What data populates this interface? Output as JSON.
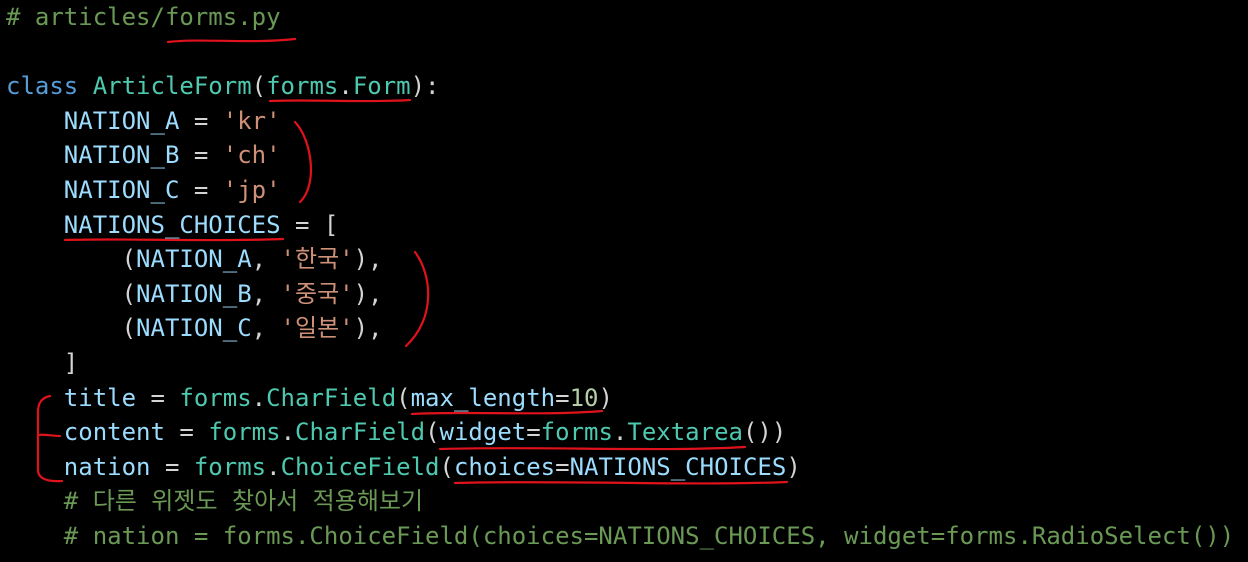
{
  "editor": {
    "language": "python",
    "lines": [
      [
        {
          "t": "# articles/forms.py",
          "c": "cm"
        }
      ],
      [],
      [
        {
          "t": "class",
          "c": "kw"
        },
        {
          "t": " ",
          "c": "pun"
        },
        {
          "t": "ArticleForm",
          "c": "cls"
        },
        {
          "t": "(",
          "c": "pun"
        },
        {
          "t": "forms",
          "c": "cls"
        },
        {
          "t": ".",
          "c": "pun"
        },
        {
          "t": "Form",
          "c": "cls"
        },
        {
          "t": "):",
          "c": "pun"
        }
      ],
      [
        {
          "t": "    ",
          "c": "pun"
        },
        {
          "t": "NATION_A",
          "c": "var"
        },
        {
          "t": " = ",
          "c": "pun"
        },
        {
          "t": "'kr'",
          "c": "str"
        }
      ],
      [
        {
          "t": "    ",
          "c": "pun"
        },
        {
          "t": "NATION_B",
          "c": "var"
        },
        {
          "t": " = ",
          "c": "pun"
        },
        {
          "t": "'ch'",
          "c": "str"
        }
      ],
      [
        {
          "t": "    ",
          "c": "pun"
        },
        {
          "t": "NATION_C",
          "c": "var"
        },
        {
          "t": " = ",
          "c": "pun"
        },
        {
          "t": "'jp'",
          "c": "str"
        }
      ],
      [
        {
          "t": "    ",
          "c": "pun"
        },
        {
          "t": "NATIONS_CHOICES",
          "c": "var"
        },
        {
          "t": " = [",
          "c": "pun"
        }
      ],
      [
        {
          "t": "        (",
          "c": "pun"
        },
        {
          "t": "NATION_A",
          "c": "var"
        },
        {
          "t": ", ",
          "c": "pun"
        },
        {
          "t": "'한국'",
          "c": "str"
        },
        {
          "t": "),",
          "c": "pun"
        }
      ],
      [
        {
          "t": "        (",
          "c": "pun"
        },
        {
          "t": "NATION_B",
          "c": "var"
        },
        {
          "t": ", ",
          "c": "pun"
        },
        {
          "t": "'중국'",
          "c": "str"
        },
        {
          "t": "),",
          "c": "pun"
        }
      ],
      [
        {
          "t": "        (",
          "c": "pun"
        },
        {
          "t": "NATION_C",
          "c": "var"
        },
        {
          "t": ", ",
          "c": "pun"
        },
        {
          "t": "'일본'",
          "c": "str"
        },
        {
          "t": "),",
          "c": "pun"
        }
      ],
      [
        {
          "t": "    ]",
          "c": "pun"
        }
      ],
      [
        {
          "t": "    ",
          "c": "pun"
        },
        {
          "t": "title",
          "c": "var"
        },
        {
          "t": " = ",
          "c": "pun"
        },
        {
          "t": "forms",
          "c": "cls"
        },
        {
          "t": ".",
          "c": "pun"
        },
        {
          "t": "CharField",
          "c": "cls"
        },
        {
          "t": "(",
          "c": "pun"
        },
        {
          "t": "max_length",
          "c": "var"
        },
        {
          "t": "=",
          "c": "pun"
        },
        {
          "t": "10",
          "c": "num"
        },
        {
          "t": ")",
          "c": "pun"
        }
      ],
      [
        {
          "t": "    ",
          "c": "pun"
        },
        {
          "t": "content",
          "c": "var"
        },
        {
          "t": " = ",
          "c": "pun"
        },
        {
          "t": "forms",
          "c": "cls"
        },
        {
          "t": ".",
          "c": "pun"
        },
        {
          "t": "CharField",
          "c": "cls"
        },
        {
          "t": "(",
          "c": "pun"
        },
        {
          "t": "widget",
          "c": "var"
        },
        {
          "t": "=",
          "c": "pun"
        },
        {
          "t": "forms",
          "c": "cls"
        },
        {
          "t": ".",
          "c": "pun"
        },
        {
          "t": "Textarea",
          "c": "cls"
        },
        {
          "t": "())",
          "c": "pun"
        }
      ],
      [
        {
          "t": "    ",
          "c": "pun"
        },
        {
          "t": "nation",
          "c": "var"
        },
        {
          "t": " = ",
          "c": "pun"
        },
        {
          "t": "forms",
          "c": "cls"
        },
        {
          "t": ".",
          "c": "pun"
        },
        {
          "t": "ChoiceField",
          "c": "cls"
        },
        {
          "t": "(",
          "c": "pun"
        },
        {
          "t": "choices",
          "c": "var"
        },
        {
          "t": "=",
          "c": "pun"
        },
        {
          "t": "NATIONS_CHOICES",
          "c": "var"
        },
        {
          "t": ")",
          "c": "pun"
        }
      ],
      [
        {
          "t": "    # 다른 위젯도 찾아서 적용해보기",
          "c": "cm"
        }
      ],
      [
        {
          "t": "    # nation = forms.ChoiceField(choices=NATIONS_CHOICES, widget=forms.RadioSelect())",
          "c": "cm"
        }
      ]
    ]
  },
  "annotations": {
    "color": "#e0121b"
  }
}
